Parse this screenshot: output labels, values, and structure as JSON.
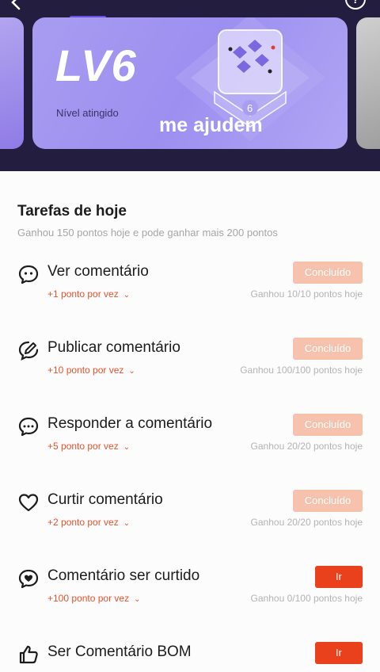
{
  "header": {
    "level_title": "LV6",
    "level_subtitle": "Nível atingido",
    "overlay_text": "me ajudem",
    "help_icon_label": "?"
  },
  "tasks_section": {
    "title": "Tarefas de hoje",
    "subtitle": "Ganhou 150 pontos hoje e pode ganhar mais 200 pontos"
  },
  "tasks": [
    {
      "name": "Ver comentário",
      "points": "+1 ponto por vez",
      "progress": "Ganhou 10/10 pontos hoje",
      "button": "Concluído",
      "icon": "comment-eye-icon"
    },
    {
      "name": "Publicar comentário",
      "points": "+10 ponto por vez",
      "progress": "Ganhou 100/100 pontos hoje",
      "button": "Concluído",
      "icon": "comment-edit-icon"
    },
    {
      "name": "Responder a comentário",
      "points": "+5 ponto por vez",
      "progress": "Ganhou 20/20 pontos hoje",
      "button": "Concluído",
      "icon": "comment-reply-icon"
    },
    {
      "name": "Curtir comentário",
      "points": "+2 ponto por vez",
      "progress": "Ganhou 20/20 pontos hoje",
      "button": "Concluído",
      "icon": "heart-icon"
    },
    {
      "name": "Comentário ser curtido",
      "points": "+100 ponto por vez",
      "progress": "Ganhou 0/100 pontos hoje",
      "button": "Ir",
      "icon": "comment-heart-icon"
    },
    {
      "name": "Ser Comentário BOM",
      "points": "",
      "progress": "",
      "button": "Ir",
      "icon": "thumbs-up-icon"
    }
  ],
  "colors": {
    "header_bg": "#231d40",
    "card_purple": "#a89cf1",
    "accent_orange": "#e8411c",
    "done_button": "#f6c1ad",
    "points_text": "#e8512a"
  }
}
